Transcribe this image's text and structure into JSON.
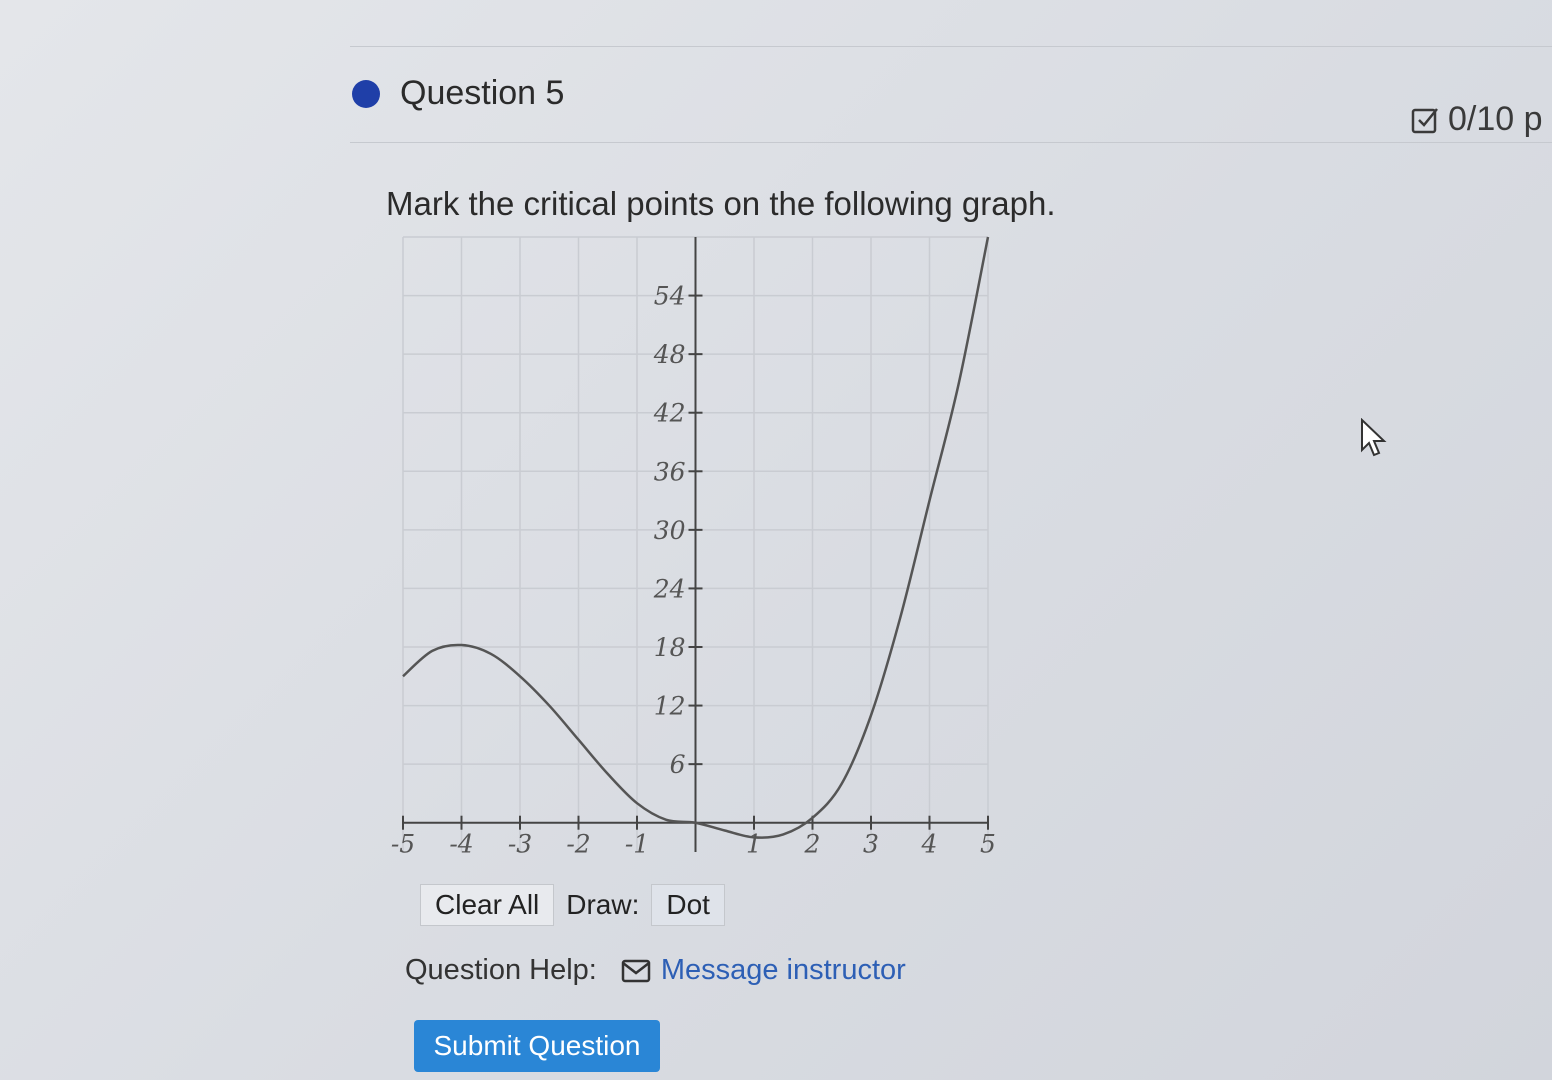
{
  "question": {
    "title": "Question 5",
    "score": "0/10 p",
    "prompt": "Mark the critical points on the following graph."
  },
  "colors": {
    "question_dot": "#1f3fa8",
    "link": "#2d5fb5",
    "submit_bg": "#2a86d6"
  },
  "icons": {
    "score": "checkbox-icon",
    "help": "mail-icon",
    "cursor": "mouse-pointer-icon"
  },
  "chart_data": {
    "type": "line",
    "xlim": [
      -5,
      5
    ],
    "ylim": [
      -3,
      60
    ],
    "x_ticks": [
      -5,
      -4,
      -3,
      -2,
      -1,
      1,
      2,
      3,
      4,
      5
    ],
    "x_tick_labels": [
      "-5",
      "-4",
      "-3",
      "-2",
      "-1",
      "1",
      "2",
      "3",
      "4",
      "5"
    ],
    "y_ticks": [
      6,
      12,
      18,
      24,
      30,
      36,
      42,
      48,
      54
    ],
    "y_tick_labels": [
      "6",
      "12",
      "18",
      "24",
      "30",
      "36",
      "42",
      "48",
      "54"
    ],
    "grid": true,
    "series": [
      {
        "x": [
          -5,
          -4.5,
          -4,
          -3.5,
          -3,
          -2.5,
          -2,
          -1.5,
          -1,
          -0.5,
          0,
          0.5,
          1,
          1.5,
          2,
          2.5,
          3,
          3.5,
          4,
          4.5,
          5
        ],
        "y": [
          15,
          17.6,
          18.2,
          17.3,
          15,
          12,
          8.5,
          5,
          2,
          0.3,
          0,
          -0.8,
          -1.5,
          -1.2,
          0.5,
          4,
          11,
          21,
          33,
          45,
          60
        ]
      }
    ]
  },
  "controls": {
    "clear_all": "Clear All",
    "draw_label": "Draw:",
    "draw_mode": "Dot"
  },
  "help": {
    "label": "Question Help:",
    "message_link": "Message instructor"
  },
  "submit_label": "Submit Question"
}
